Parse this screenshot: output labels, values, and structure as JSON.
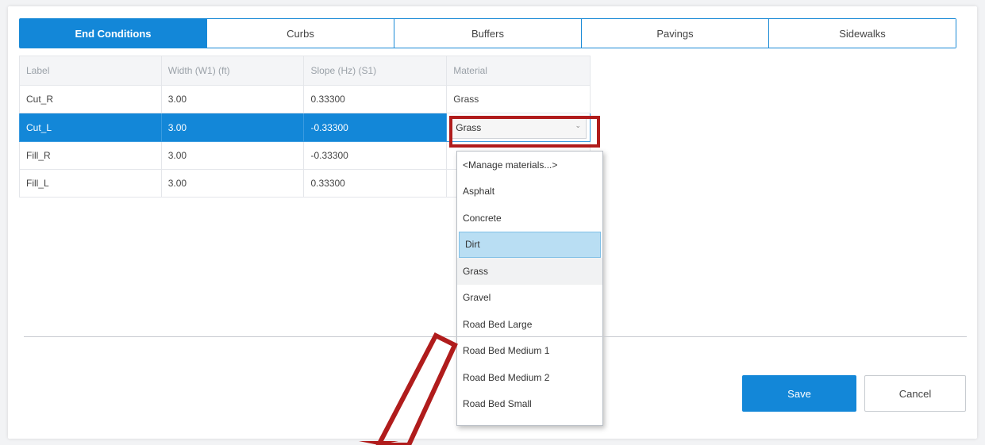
{
  "tabs": [
    {
      "label": "End Conditions",
      "active": true
    },
    {
      "label": "Curbs",
      "active": false
    },
    {
      "label": "Buffers",
      "active": false
    },
    {
      "label": "Pavings",
      "active": false
    },
    {
      "label": "Sidewalks",
      "active": false
    }
  ],
  "table": {
    "columns": [
      "Label",
      "Width (W1) (ft)",
      "Slope (Hz) (S1)",
      "Material"
    ],
    "rows": [
      {
        "label": "Cut_R",
        "width": "3.00",
        "slope": "0.33300",
        "material": "Grass"
      },
      {
        "label": "Cut_L",
        "width": "3.00",
        "slope": "-0.33300",
        "material": "Grass"
      },
      {
        "label": "Fill_R",
        "width": "3.00",
        "slope": "-0.33300",
        "material": ""
      },
      {
        "label": "Fill_L",
        "width": "3.00",
        "slope": "0.33300",
        "material": ""
      }
    ]
  },
  "material_dropdown": {
    "selected": "Grass",
    "options": [
      "<Manage materials...>",
      "Asphalt",
      "Concrete",
      "Dirt",
      "Grass",
      "Gravel",
      "Road Bed Large",
      "Road Bed Medium 1",
      "Road Bed Medium 2",
      "Road Bed Small"
    ],
    "hovered": "Dirt"
  },
  "buttons": {
    "save": "Save",
    "cancel": "Cancel"
  },
  "colors": {
    "accent": "#1387d8",
    "annotation": "#b01c1c",
    "hover": "#b9def3"
  },
  "icons": {
    "dropdown_chevron": "chevron-down-icon"
  }
}
